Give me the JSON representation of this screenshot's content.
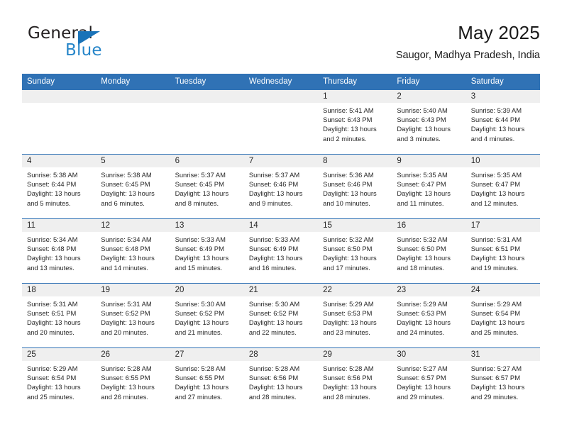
{
  "brand": {
    "line1": "General",
    "line2": "Blue",
    "triangle_color": "#1a73b8",
    "blue_color": "#2786c9"
  },
  "header": {
    "title": "May 2025",
    "subtitle": "Saugor, Madhya Pradesh, India"
  },
  "theme": {
    "header_blue": "#3072b5",
    "daynum_band": "#efefef",
    "text": "#262626"
  },
  "weekdays": [
    "Sunday",
    "Monday",
    "Tuesday",
    "Wednesday",
    "Thursday",
    "Friday",
    "Saturday"
  ],
  "labels": {
    "sunrise": "Sunrise:",
    "sunset": "Sunset:",
    "daylight": "Daylight:"
  },
  "weeks": [
    [
      {
        "day": "",
        "empty": true
      },
      {
        "day": "",
        "empty": true
      },
      {
        "day": "",
        "empty": true
      },
      {
        "day": "",
        "empty": true
      },
      {
        "day": "1",
        "sunrise": "Sunrise: 5:41 AM",
        "sunset": "Sunset: 6:43 PM",
        "daylight_l1": "Daylight: 13 hours",
        "daylight_l2": "and 2 minutes."
      },
      {
        "day": "2",
        "sunrise": "Sunrise: 5:40 AM",
        "sunset": "Sunset: 6:43 PM",
        "daylight_l1": "Daylight: 13 hours",
        "daylight_l2": "and 3 minutes."
      },
      {
        "day": "3",
        "sunrise": "Sunrise: 5:39 AM",
        "sunset": "Sunset: 6:44 PM",
        "daylight_l1": "Daylight: 13 hours",
        "daylight_l2": "and 4 minutes."
      }
    ],
    [
      {
        "day": "4",
        "sunrise": "Sunrise: 5:38 AM",
        "sunset": "Sunset: 6:44 PM",
        "daylight_l1": "Daylight: 13 hours",
        "daylight_l2": "and 5 minutes."
      },
      {
        "day": "5",
        "sunrise": "Sunrise: 5:38 AM",
        "sunset": "Sunset: 6:45 PM",
        "daylight_l1": "Daylight: 13 hours",
        "daylight_l2": "and 6 minutes."
      },
      {
        "day": "6",
        "sunrise": "Sunrise: 5:37 AM",
        "sunset": "Sunset: 6:45 PM",
        "daylight_l1": "Daylight: 13 hours",
        "daylight_l2": "and 8 minutes."
      },
      {
        "day": "7",
        "sunrise": "Sunrise: 5:37 AM",
        "sunset": "Sunset: 6:46 PM",
        "daylight_l1": "Daylight: 13 hours",
        "daylight_l2": "and 9 minutes."
      },
      {
        "day": "8",
        "sunrise": "Sunrise: 5:36 AM",
        "sunset": "Sunset: 6:46 PM",
        "daylight_l1": "Daylight: 13 hours",
        "daylight_l2": "and 10 minutes."
      },
      {
        "day": "9",
        "sunrise": "Sunrise: 5:35 AM",
        "sunset": "Sunset: 6:47 PM",
        "daylight_l1": "Daylight: 13 hours",
        "daylight_l2": "and 11 minutes."
      },
      {
        "day": "10",
        "sunrise": "Sunrise: 5:35 AM",
        "sunset": "Sunset: 6:47 PM",
        "daylight_l1": "Daylight: 13 hours",
        "daylight_l2": "and 12 minutes."
      }
    ],
    [
      {
        "day": "11",
        "sunrise": "Sunrise: 5:34 AM",
        "sunset": "Sunset: 6:48 PM",
        "daylight_l1": "Daylight: 13 hours",
        "daylight_l2": "and 13 minutes."
      },
      {
        "day": "12",
        "sunrise": "Sunrise: 5:34 AM",
        "sunset": "Sunset: 6:48 PM",
        "daylight_l1": "Daylight: 13 hours",
        "daylight_l2": "and 14 minutes."
      },
      {
        "day": "13",
        "sunrise": "Sunrise: 5:33 AM",
        "sunset": "Sunset: 6:49 PM",
        "daylight_l1": "Daylight: 13 hours",
        "daylight_l2": "and 15 minutes."
      },
      {
        "day": "14",
        "sunrise": "Sunrise: 5:33 AM",
        "sunset": "Sunset: 6:49 PM",
        "daylight_l1": "Daylight: 13 hours",
        "daylight_l2": "and 16 minutes."
      },
      {
        "day": "15",
        "sunrise": "Sunrise: 5:32 AM",
        "sunset": "Sunset: 6:50 PM",
        "daylight_l1": "Daylight: 13 hours",
        "daylight_l2": "and 17 minutes."
      },
      {
        "day": "16",
        "sunrise": "Sunrise: 5:32 AM",
        "sunset": "Sunset: 6:50 PM",
        "daylight_l1": "Daylight: 13 hours",
        "daylight_l2": "and 18 minutes."
      },
      {
        "day": "17",
        "sunrise": "Sunrise: 5:31 AM",
        "sunset": "Sunset: 6:51 PM",
        "daylight_l1": "Daylight: 13 hours",
        "daylight_l2": "and 19 minutes."
      }
    ],
    [
      {
        "day": "18",
        "sunrise": "Sunrise: 5:31 AM",
        "sunset": "Sunset: 6:51 PM",
        "daylight_l1": "Daylight: 13 hours",
        "daylight_l2": "and 20 minutes."
      },
      {
        "day": "19",
        "sunrise": "Sunrise: 5:31 AM",
        "sunset": "Sunset: 6:52 PM",
        "daylight_l1": "Daylight: 13 hours",
        "daylight_l2": "and 20 minutes."
      },
      {
        "day": "20",
        "sunrise": "Sunrise: 5:30 AM",
        "sunset": "Sunset: 6:52 PM",
        "daylight_l1": "Daylight: 13 hours",
        "daylight_l2": "and 21 minutes."
      },
      {
        "day": "21",
        "sunrise": "Sunrise: 5:30 AM",
        "sunset": "Sunset: 6:52 PM",
        "daylight_l1": "Daylight: 13 hours",
        "daylight_l2": "and 22 minutes."
      },
      {
        "day": "22",
        "sunrise": "Sunrise: 5:29 AM",
        "sunset": "Sunset: 6:53 PM",
        "daylight_l1": "Daylight: 13 hours",
        "daylight_l2": "and 23 minutes."
      },
      {
        "day": "23",
        "sunrise": "Sunrise: 5:29 AM",
        "sunset": "Sunset: 6:53 PM",
        "daylight_l1": "Daylight: 13 hours",
        "daylight_l2": "and 24 minutes."
      },
      {
        "day": "24",
        "sunrise": "Sunrise: 5:29 AM",
        "sunset": "Sunset: 6:54 PM",
        "daylight_l1": "Daylight: 13 hours",
        "daylight_l2": "and 25 minutes."
      }
    ],
    [
      {
        "day": "25",
        "sunrise": "Sunrise: 5:29 AM",
        "sunset": "Sunset: 6:54 PM",
        "daylight_l1": "Daylight: 13 hours",
        "daylight_l2": "and 25 minutes."
      },
      {
        "day": "26",
        "sunrise": "Sunrise: 5:28 AM",
        "sunset": "Sunset: 6:55 PM",
        "daylight_l1": "Daylight: 13 hours",
        "daylight_l2": "and 26 minutes."
      },
      {
        "day": "27",
        "sunrise": "Sunrise: 5:28 AM",
        "sunset": "Sunset: 6:55 PM",
        "daylight_l1": "Daylight: 13 hours",
        "daylight_l2": "and 27 minutes."
      },
      {
        "day": "28",
        "sunrise": "Sunrise: 5:28 AM",
        "sunset": "Sunset: 6:56 PM",
        "daylight_l1": "Daylight: 13 hours",
        "daylight_l2": "and 28 minutes."
      },
      {
        "day": "29",
        "sunrise": "Sunrise: 5:28 AM",
        "sunset": "Sunset: 6:56 PM",
        "daylight_l1": "Daylight: 13 hours",
        "daylight_l2": "and 28 minutes."
      },
      {
        "day": "30",
        "sunrise": "Sunrise: 5:27 AM",
        "sunset": "Sunset: 6:57 PM",
        "daylight_l1": "Daylight: 13 hours",
        "daylight_l2": "and 29 minutes."
      },
      {
        "day": "31",
        "sunrise": "Sunrise: 5:27 AM",
        "sunset": "Sunset: 6:57 PM",
        "daylight_l1": "Daylight: 13 hours",
        "daylight_l2": "and 29 minutes."
      }
    ]
  ]
}
